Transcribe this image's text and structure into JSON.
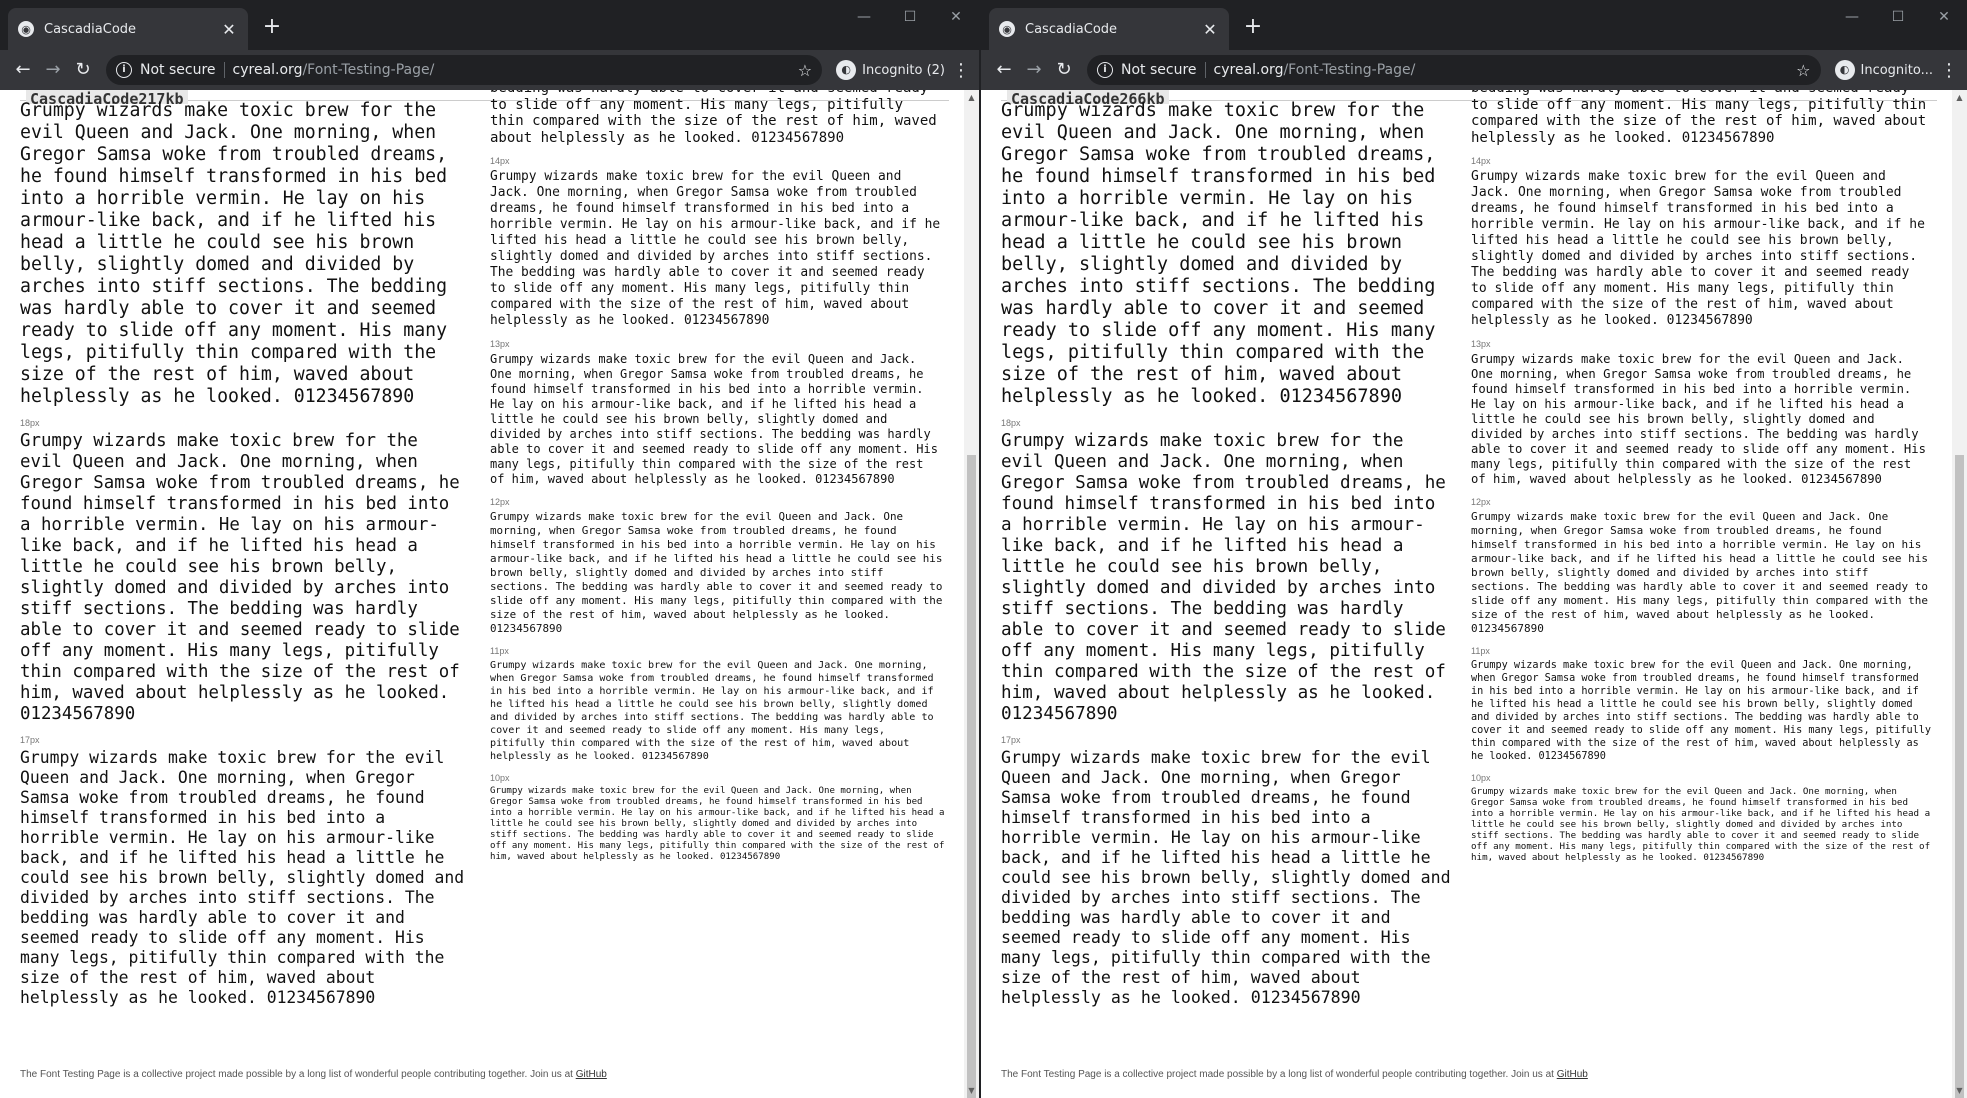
{
  "sample_text": "Grumpy wizards make toxic brew for the evil Queen and Jack. One morning, when Gregor Samsa woke from troubled dreams, he found himself transformed in his bed into a horrible vermin. He lay on his armour-like back, and if he lifted his head a little he could see his brown belly, slightly domed and divided by arches into stiff sections. The bedding was hardly able to cover it and seemed ready to slide off any moment. His many legs, pitifully thin compared with the size of the rest of him, waved about helplessly as he looked. 01234567890",
  "top_fragment_text": "bedding was hardly able to cover it and seemed ready to slide off any moment. His many legs, pitifully thin compared with the size of the rest of him, waved about helplessly as he looked. 01234567890",
  "size_labels": {
    "s18": "18px",
    "s17": "17px",
    "s14": "14px",
    "s13": "13px",
    "s12": "12px",
    "s11": "11px",
    "s10": "10px"
  },
  "footer": {
    "text": "The Font Testing Page is a collective project made possible by a long list of wonderful people contributing together. Join us at",
    "link": "GitHub"
  },
  "left_window": {
    "tab_title": "CascadiaCode",
    "security_label": "Not secure",
    "url_host": "cyreal.org",
    "url_path": "/Font-Testing-Page/",
    "profile_label": "Incognito (2)",
    "font_label": "CascadiaCode217kb"
  },
  "right_window": {
    "tab_title": "CascadiaCode",
    "security_label": "Not secure",
    "url_host": "cyreal.org",
    "url_path": "/Font-Testing-Page/",
    "profile_label": "Incognito...",
    "font_label": "CascadiaCode266kb"
  },
  "icons": {
    "tab_favicon": "chrome-globe-icon",
    "close_tab": "close-icon",
    "new_tab": "plus-icon",
    "back": "arrow-left-icon",
    "forward": "arrow-right-icon",
    "reload": "reload-icon",
    "info": "info-icon",
    "bookmark": "star-icon",
    "incognito": "incognito-icon",
    "menu": "kebab-menu-icon"
  }
}
